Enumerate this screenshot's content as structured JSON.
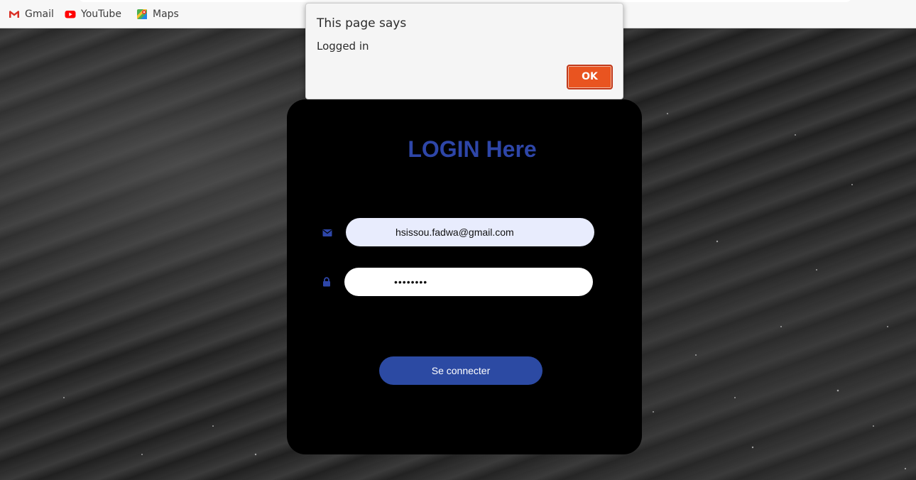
{
  "bookmarks": [
    {
      "label": "Gmail",
      "icon": "gmail-icon"
    },
    {
      "label": "YouTube",
      "icon": "youtube-icon"
    },
    {
      "label": "Maps",
      "icon": "maps-icon"
    }
  ],
  "alert": {
    "title": "This page says",
    "message": "Logged in",
    "ok_label": "OK"
  },
  "login": {
    "title": "LOGIN Here",
    "email_value": "hsissou.fadwa@gmail.com",
    "password_value": "••••••••",
    "email_icon": "envelope-icon",
    "password_icon": "lock-icon",
    "submit_label": "Se connecter"
  },
  "colors": {
    "title": "#2e46a8",
    "submit_bg": "#2c4aa3",
    "ok_bg": "#e95420",
    "card_bg": "#000000"
  }
}
